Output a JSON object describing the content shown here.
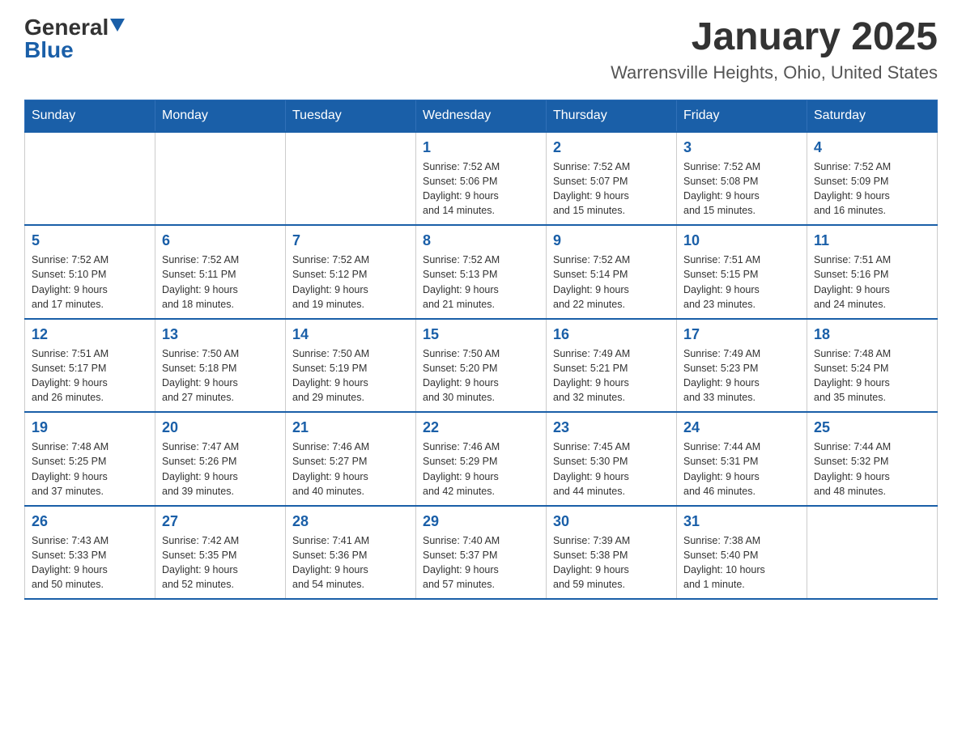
{
  "header": {
    "logo": {
      "general": "General",
      "blue": "Blue",
      "arrow": "▼"
    },
    "title": "January 2025",
    "location": "Warrensville Heights, Ohio, United States"
  },
  "days_of_week": [
    "Sunday",
    "Monday",
    "Tuesday",
    "Wednesday",
    "Thursday",
    "Friday",
    "Saturday"
  ],
  "weeks": [
    [
      {
        "day": "",
        "info": ""
      },
      {
        "day": "",
        "info": ""
      },
      {
        "day": "",
        "info": ""
      },
      {
        "day": "1",
        "info": "Sunrise: 7:52 AM\nSunset: 5:06 PM\nDaylight: 9 hours\nand 14 minutes."
      },
      {
        "day": "2",
        "info": "Sunrise: 7:52 AM\nSunset: 5:07 PM\nDaylight: 9 hours\nand 15 minutes."
      },
      {
        "day": "3",
        "info": "Sunrise: 7:52 AM\nSunset: 5:08 PM\nDaylight: 9 hours\nand 15 minutes."
      },
      {
        "day": "4",
        "info": "Sunrise: 7:52 AM\nSunset: 5:09 PM\nDaylight: 9 hours\nand 16 minutes."
      }
    ],
    [
      {
        "day": "5",
        "info": "Sunrise: 7:52 AM\nSunset: 5:10 PM\nDaylight: 9 hours\nand 17 minutes."
      },
      {
        "day": "6",
        "info": "Sunrise: 7:52 AM\nSunset: 5:11 PM\nDaylight: 9 hours\nand 18 minutes."
      },
      {
        "day": "7",
        "info": "Sunrise: 7:52 AM\nSunset: 5:12 PM\nDaylight: 9 hours\nand 19 minutes."
      },
      {
        "day": "8",
        "info": "Sunrise: 7:52 AM\nSunset: 5:13 PM\nDaylight: 9 hours\nand 21 minutes."
      },
      {
        "day": "9",
        "info": "Sunrise: 7:52 AM\nSunset: 5:14 PM\nDaylight: 9 hours\nand 22 minutes."
      },
      {
        "day": "10",
        "info": "Sunrise: 7:51 AM\nSunset: 5:15 PM\nDaylight: 9 hours\nand 23 minutes."
      },
      {
        "day": "11",
        "info": "Sunrise: 7:51 AM\nSunset: 5:16 PM\nDaylight: 9 hours\nand 24 minutes."
      }
    ],
    [
      {
        "day": "12",
        "info": "Sunrise: 7:51 AM\nSunset: 5:17 PM\nDaylight: 9 hours\nand 26 minutes."
      },
      {
        "day": "13",
        "info": "Sunrise: 7:50 AM\nSunset: 5:18 PM\nDaylight: 9 hours\nand 27 minutes."
      },
      {
        "day": "14",
        "info": "Sunrise: 7:50 AM\nSunset: 5:19 PM\nDaylight: 9 hours\nand 29 minutes."
      },
      {
        "day": "15",
        "info": "Sunrise: 7:50 AM\nSunset: 5:20 PM\nDaylight: 9 hours\nand 30 minutes."
      },
      {
        "day": "16",
        "info": "Sunrise: 7:49 AM\nSunset: 5:21 PM\nDaylight: 9 hours\nand 32 minutes."
      },
      {
        "day": "17",
        "info": "Sunrise: 7:49 AM\nSunset: 5:23 PM\nDaylight: 9 hours\nand 33 minutes."
      },
      {
        "day": "18",
        "info": "Sunrise: 7:48 AM\nSunset: 5:24 PM\nDaylight: 9 hours\nand 35 minutes."
      }
    ],
    [
      {
        "day": "19",
        "info": "Sunrise: 7:48 AM\nSunset: 5:25 PM\nDaylight: 9 hours\nand 37 minutes."
      },
      {
        "day": "20",
        "info": "Sunrise: 7:47 AM\nSunset: 5:26 PM\nDaylight: 9 hours\nand 39 minutes."
      },
      {
        "day": "21",
        "info": "Sunrise: 7:46 AM\nSunset: 5:27 PM\nDaylight: 9 hours\nand 40 minutes."
      },
      {
        "day": "22",
        "info": "Sunrise: 7:46 AM\nSunset: 5:29 PM\nDaylight: 9 hours\nand 42 minutes."
      },
      {
        "day": "23",
        "info": "Sunrise: 7:45 AM\nSunset: 5:30 PM\nDaylight: 9 hours\nand 44 minutes."
      },
      {
        "day": "24",
        "info": "Sunrise: 7:44 AM\nSunset: 5:31 PM\nDaylight: 9 hours\nand 46 minutes."
      },
      {
        "day": "25",
        "info": "Sunrise: 7:44 AM\nSunset: 5:32 PM\nDaylight: 9 hours\nand 48 minutes."
      }
    ],
    [
      {
        "day": "26",
        "info": "Sunrise: 7:43 AM\nSunset: 5:33 PM\nDaylight: 9 hours\nand 50 minutes."
      },
      {
        "day": "27",
        "info": "Sunrise: 7:42 AM\nSunset: 5:35 PM\nDaylight: 9 hours\nand 52 minutes."
      },
      {
        "day": "28",
        "info": "Sunrise: 7:41 AM\nSunset: 5:36 PM\nDaylight: 9 hours\nand 54 minutes."
      },
      {
        "day": "29",
        "info": "Sunrise: 7:40 AM\nSunset: 5:37 PM\nDaylight: 9 hours\nand 57 minutes."
      },
      {
        "day": "30",
        "info": "Sunrise: 7:39 AM\nSunset: 5:38 PM\nDaylight: 9 hours\nand 59 minutes."
      },
      {
        "day": "31",
        "info": "Sunrise: 7:38 AM\nSunset: 5:40 PM\nDaylight: 10 hours\nand 1 minute."
      },
      {
        "day": "",
        "info": ""
      }
    ]
  ]
}
